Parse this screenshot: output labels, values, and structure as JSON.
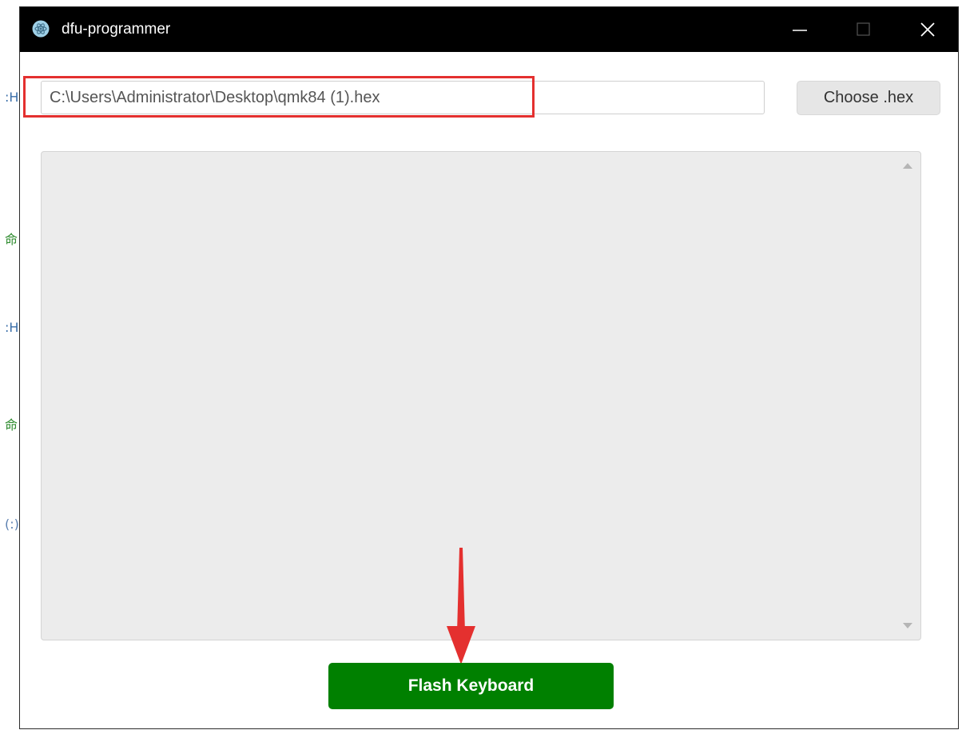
{
  "window": {
    "title": "dfu-programmer",
    "controls": [
      "minimize-icon",
      "maximize-icon",
      "close-icon"
    ]
  },
  "file": {
    "path_value": "C:\\Users\\Administrator\\Desktop\\qmk84 (1).hex",
    "choose_label": "Choose .hex"
  },
  "log": {
    "content": ""
  },
  "actions": {
    "flash_label": "Flash Keyboard"
  },
  "background_strip": {
    "glyphs": [
      ":H",
      "命",
      ":H",
      "命",
      "(:)"
    ]
  },
  "colors": {
    "titlebar": "#000000",
    "highlight": "#e4302f",
    "flash_button": "#008000",
    "log_background": "#ececec",
    "arrow": "#e4302f"
  }
}
